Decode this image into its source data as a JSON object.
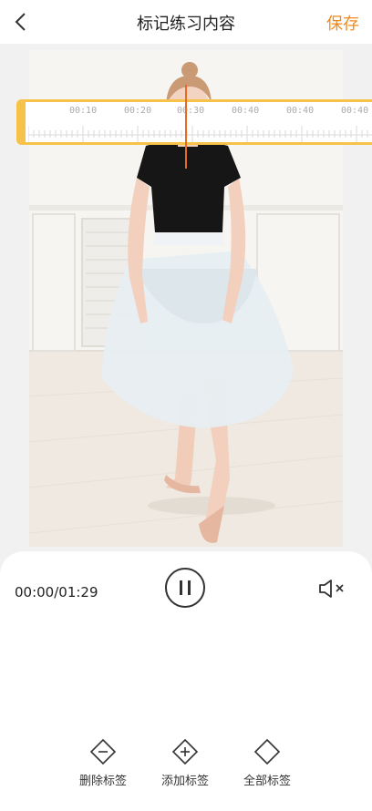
{
  "header": {
    "title": "标记练习内容",
    "save_label": "保存"
  },
  "icons": {
    "back": "chevron-left-icon",
    "play_pause": "pause-icon",
    "mute": "speaker-muted-icon",
    "delete": "minus-diamond-icon",
    "add": "plus-diamond-icon",
    "all": "diamond-icon"
  },
  "player": {
    "time": "00:00/01:29"
  },
  "timeline": {
    "labels": [
      "00:10",
      "00:20",
      "00:30",
      "00:40",
      "00:40",
      "00:40"
    ]
  },
  "actions": {
    "delete_label": "删除标签",
    "add_label": "添加标签",
    "all_label": "全部标签"
  },
  "colors": {
    "accent": "#f08a1c",
    "timeline_border": "#f7c24a",
    "playhead": "#e66a1f"
  }
}
